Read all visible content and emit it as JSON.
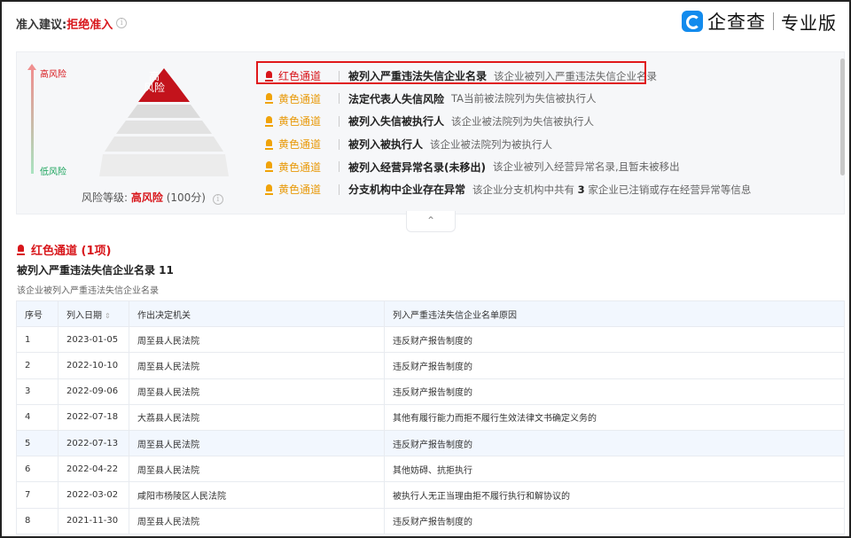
{
  "header": {
    "label": "准入建议:",
    "value": "拒绝准入"
  },
  "brand": {
    "name": "企查查",
    "edition": "专业版",
    "color": "#128bed"
  },
  "risk_panel": {
    "axis_high": "高风险",
    "axis_low": "低风险",
    "pyramid_top": "高\n风险",
    "level_prefix": "风险等级:",
    "level_value": "高风险",
    "level_score": "(100分)",
    "items": [
      {
        "channel": "红色通道",
        "color": "red",
        "title": "被列入严重违法失信企业名录",
        "desc": "该企业被列入严重违法失信企业名录"
      },
      {
        "channel": "黄色通道",
        "color": "yellow",
        "title": "法定代表人失信风险",
        "desc": "TA当前被法院列为失信被执行人"
      },
      {
        "channel": "黄色通道",
        "color": "yellow",
        "title": "被列入失信被执行人",
        "desc": "该企业被法院列为失信被执行人"
      },
      {
        "channel": "黄色通道",
        "color": "yellow",
        "title": "被列入被执行人",
        "desc": "该企业被法院列为被执行人"
      },
      {
        "channel": "黄色通道",
        "color": "yellow",
        "title": "被列入经营异常名录(未移出)",
        "desc": "该企业被列入经营异常名录,且暂未被移出"
      },
      {
        "channel": "黄色通道",
        "color": "yellow",
        "title": "分支机构中企业存在异常",
        "desc_pre": "该企业分支机构中共有 ",
        "desc_num": "3",
        "desc_post": " 家企业已注销或存在经营异常等信息"
      }
    ],
    "collapse_icon": "chevron-up-icon"
  },
  "section": {
    "title": "红色通道 (1项)",
    "subtitle": "被列入严重违法失信企业名录 11",
    "desc": "该企业被列入严重违法失信企业名录"
  },
  "table": {
    "headers": [
      "序号",
      "列入日期",
      "作出决定机关",
      "列入严重违法失信企业名单原因"
    ],
    "rows": [
      [
        "1",
        "2023-01-05",
        "周至县人民法院",
        "违反财产报告制度的"
      ],
      [
        "2",
        "2022-10-10",
        "周至县人民法院",
        "违反财产报告制度的"
      ],
      [
        "3",
        "2022-09-06",
        "周至县人民法院",
        "违反财产报告制度的"
      ],
      [
        "4",
        "2022-07-18",
        "大荔县人民法院",
        "其他有履行能力而拒不履行生效法律文书确定义务的"
      ],
      [
        "5",
        "2022-07-13",
        "周至县人民法院",
        "违反财产报告制度的"
      ],
      [
        "6",
        "2022-04-22",
        "周至县人民法院",
        "其他妨碍、抗拒执行"
      ],
      [
        "7",
        "2022-03-02",
        "咸阳市杨陵区人民法院",
        "被执行人无正当理由拒不履行执行和解协议的"
      ],
      [
        "8",
        "2021-11-30",
        "周至县人民法院",
        "违反财产报告制度的"
      ]
    ]
  }
}
